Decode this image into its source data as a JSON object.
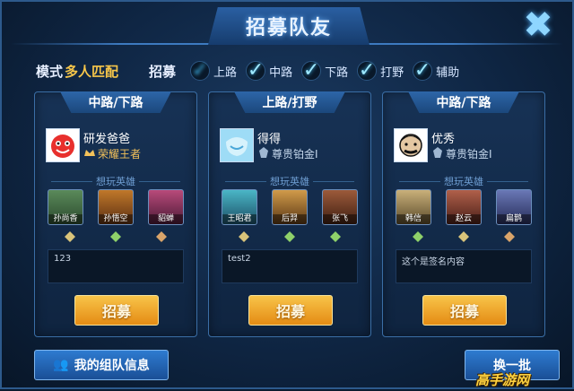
{
  "dialog": {
    "title": "招募队友",
    "close_symbol": "✖",
    "colors": {
      "accent": "#f6c64a",
      "panel_blue": "#173255",
      "button_orange": "#e48b14"
    }
  },
  "filters": {
    "mode_label": "模式",
    "mode_value": "多人匹配",
    "recruit_label": "招募",
    "positions": [
      {
        "label": "上路",
        "checked": false
      },
      {
        "label": "中路",
        "checked": true
      },
      {
        "label": "下路",
        "checked": true
      },
      {
        "label": "打野",
        "checked": true
      },
      {
        "label": "辅助",
        "checked": true
      }
    ]
  },
  "cards": [
    {
      "position": "中路/下路",
      "player_name": "研发爸爸",
      "rank": "荣耀王者",
      "rank_color": "#f4c25a",
      "heroes_label": "想玩英雄",
      "heroes": [
        "孙尚香",
        "孙悟空",
        "貂蝉"
      ],
      "signature": "123",
      "button": "招募"
    },
    {
      "position": "上路/打野",
      "player_name": "得得",
      "rank": "尊贵铂金I",
      "rank_color": "#c5d7ec",
      "heroes_label": "想玩英雄",
      "heroes": [
        "王昭君",
        "后羿",
        "张飞"
      ],
      "signature": "test2",
      "button": "招募"
    },
    {
      "position": "中路/下路",
      "player_name": "优秀",
      "rank": "尊贵铂金I",
      "rank_color": "#c5d7ec",
      "heroes_label": "想玩英雄",
      "heroes": [
        "韩信",
        "赵云",
        "扁鹊"
      ],
      "signature": "这个是签名内容",
      "button": "招募"
    }
  ],
  "footer": {
    "team_info_icon": "team-icon",
    "team_info": "我的组队信息",
    "change_batch": "换一批",
    "watermark": "高手游网"
  }
}
